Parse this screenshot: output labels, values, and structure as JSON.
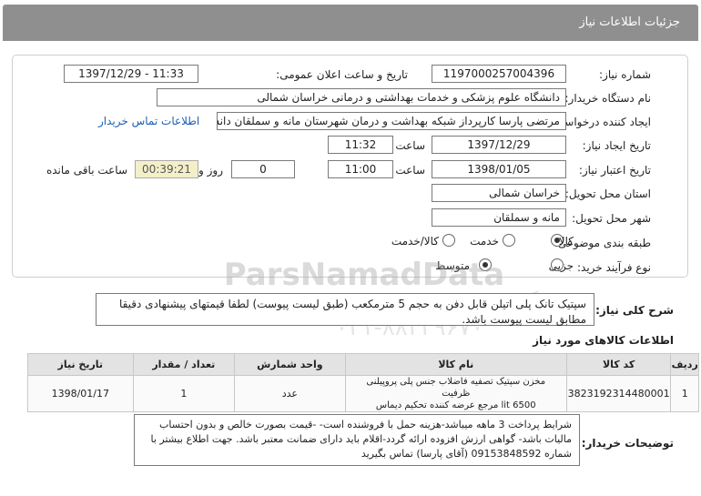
{
  "header": {
    "title": "جزئیات اطلاعات نیاز"
  },
  "form": {
    "need_number_label": "شماره نیاز:",
    "need_number": "1197000257004396",
    "announce_label": "تاریخ و ساعت اعلان عمومی:",
    "announce_value": "1397/12/29 - 11:33",
    "buyer_org_label": "نام دستگاه خریدار:",
    "buyer_org": "دانشگاه علوم پزشکی و خدمات بهداشتی و درمانی خراسان شمالی",
    "requester_label": "ایجاد کننده درخواست:",
    "requester": "مرتضی پارسا کارپرداز شبکه بهداشت و درمان شهرستان مانه و سملقان دانشگاه",
    "contact_link": "اطلاعات تماس خریدار",
    "create_date_label": "تاریخ ایجاد نیاز:",
    "create_date": "1397/12/29",
    "time_label": "ساعت",
    "create_time": "11:32",
    "validity_label": "تاریخ اعتبار نیاز:",
    "validity_date": "1398/01/05",
    "validity_time": "11:00",
    "days_value": "0",
    "days_label": "روز و",
    "remaining_time": "00:39:21",
    "remaining_label": "ساعت باقی مانده",
    "province_label": "استان محل تحویل:",
    "province": "خراسان شمالی",
    "city_label": "شهر محل تحویل:",
    "city": "مانه و سملقان",
    "category_label": "طبقه بندی موضوعی:",
    "category_options": [
      "کالا",
      "خدمت",
      "کالا/خدمت"
    ],
    "process_label": "نوع فرآیند خرید:",
    "process_options": [
      "جزیی",
      "متوسط"
    ]
  },
  "summary": {
    "label": "شرح کلی نیاز:",
    "text": "سپتیک تانک پلی اتیلن قابل دفن به حجم 5 مترمکعب (طبق لیست پیوست) لطفا قیمتهای پیشنهادی دقیقا مطابق لیست پیوست باشد."
  },
  "items": {
    "title": "اطلاعات کالاهای مورد نیاز",
    "columns": [
      "ردیف",
      "کد کالا",
      "نام کالا",
      "واحد شمارش",
      "تعداد / مقدار",
      "تاریخ نیاز"
    ],
    "rows": [
      {
        "row": "1",
        "code": "3823192314480001",
        "name_line1": "مخزن سپتیک تصفیه فاضلاب جنس پلی پروپیلنی ظرفیت",
        "name_line2": "6500 lit مرجع عرضه کننده تحکیم دیماس",
        "unit": "عدد",
        "qty": "1",
        "date": "1398/01/17"
      }
    ]
  },
  "notes": {
    "label": "توضیحات خریدار:",
    "line1": "شرایط پرداخت 3 ماهه میباشد-هزینه حمل با فروشنده است- -قیمت بصورت خالص و بدون احتساب",
    "line2": "مالیات باشد- گواهی ارزش افزوده ارائه گردد-اقلام باید دارای ضمانت معتبر باشد. جهت اطلاع بیشتر با",
    "line3": "شماره 09153848592 (آقای پارسا) تماس بگیرید"
  },
  "watermark": {
    "brand": "ParsNamadData",
    "line2": "پایگاه اطلاع رسانی مناقصه ومزایده",
    "phone": "۰۲۱-۸۸۳۴۹۶۷۰"
  }
}
